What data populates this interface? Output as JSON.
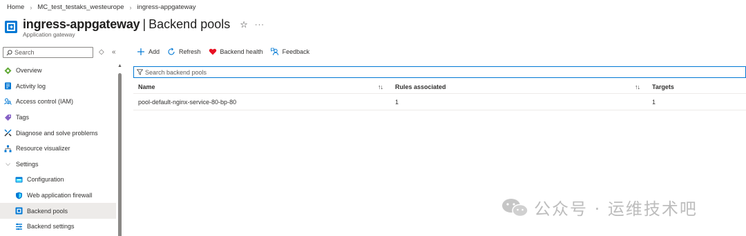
{
  "breadcrumb": [
    "Home",
    "MC_test_testaks_westeurope",
    "ingress-appgateway"
  ],
  "header": {
    "resource_name": "ingress-appgateway",
    "separator": "|",
    "page_name": "Backend pools",
    "subtitle": "Application gateway"
  },
  "sidebar": {
    "search_placeholder": "Search",
    "items": [
      {
        "label": "Overview",
        "icon": "overview-icon"
      },
      {
        "label": "Activity log",
        "icon": "activity-log-icon"
      },
      {
        "label": "Access control (IAM)",
        "icon": "iam-icon"
      },
      {
        "label": "Tags",
        "icon": "tag-icon"
      },
      {
        "label": "Diagnose and solve problems",
        "icon": "diagnose-icon"
      },
      {
        "label": "Resource visualizer",
        "icon": "visualizer-icon"
      },
      {
        "label": "Settings",
        "icon": "chevron-down-icon"
      },
      {
        "label": "Configuration",
        "icon": "configuration-icon"
      },
      {
        "label": "Web application firewall",
        "icon": "shield-icon"
      },
      {
        "label": "Backend pools",
        "icon": "backend-pools-icon"
      },
      {
        "label": "Backend settings",
        "icon": "backend-settings-icon"
      }
    ],
    "active_item": "Backend pools"
  },
  "toolbar": {
    "add": "Add",
    "refresh": "Refresh",
    "backend_health": "Backend health",
    "feedback": "Feedback"
  },
  "filter": {
    "placeholder": "Search backend pools"
  },
  "table": {
    "columns": [
      "Name",
      "Rules associated",
      "Targets"
    ],
    "rows": [
      {
        "name": "pool-default-nginx-service-80-bp-80",
        "rules": "1",
        "targets": "1"
      }
    ]
  },
  "watermark": {
    "text": "公众号 · 运维技术吧"
  },
  "colors": {
    "accent": "#0078d4",
    "heart": "#e81123",
    "active_bg": "#edebe9"
  }
}
